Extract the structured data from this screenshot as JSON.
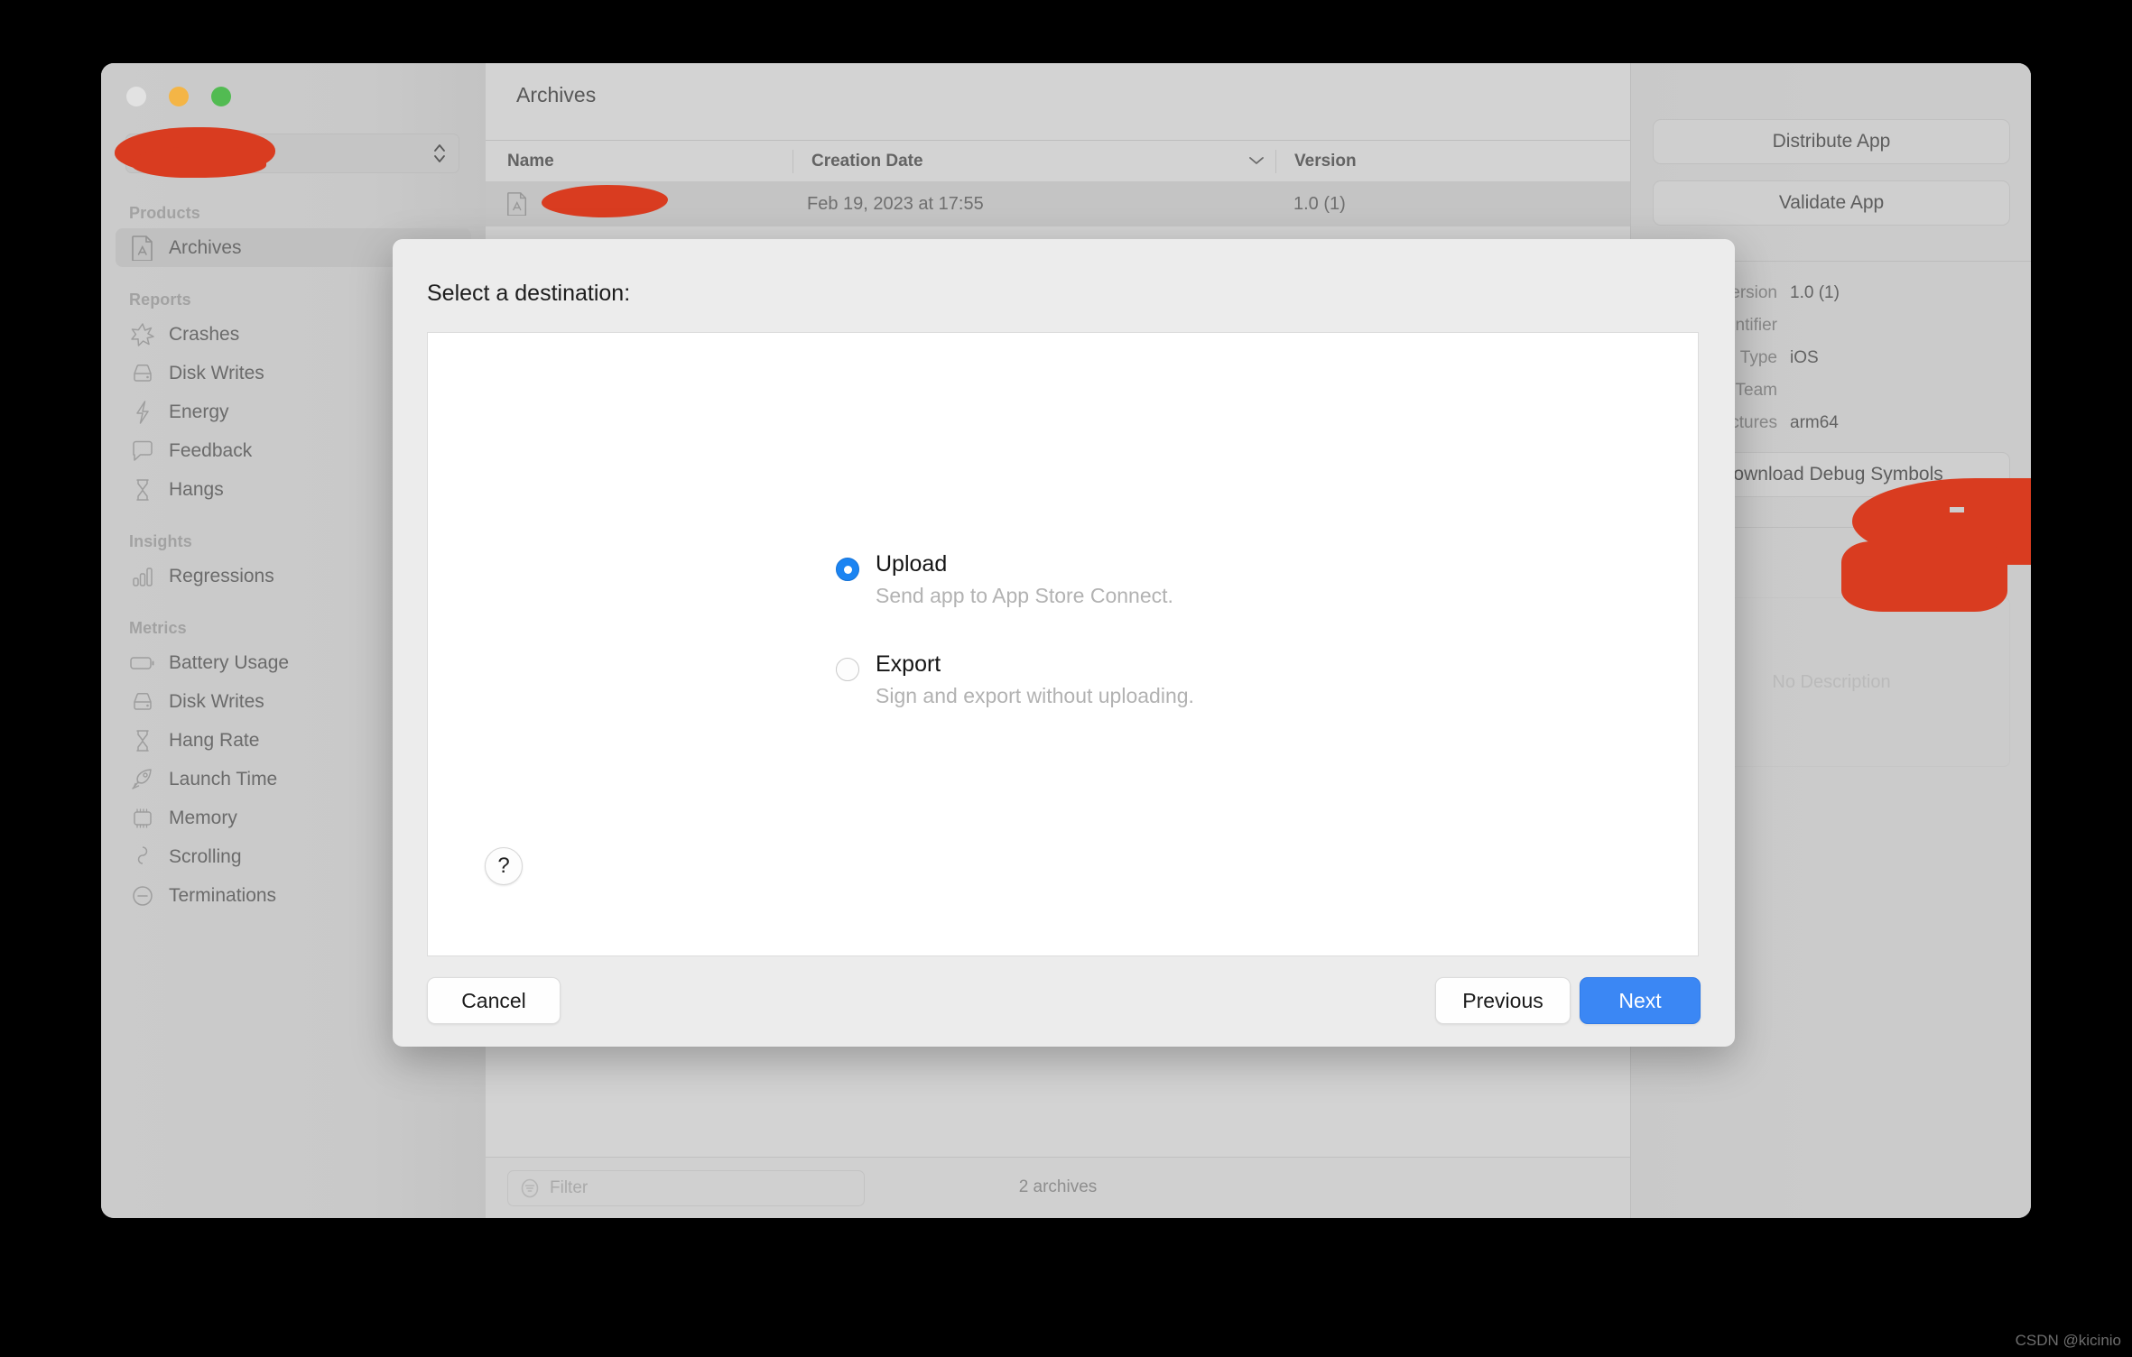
{
  "window": {
    "traffic_lights": [
      "close",
      "minimize",
      "zoom"
    ],
    "scheme_popup_value": ""
  },
  "sidebar": {
    "groups": [
      {
        "label": "Products",
        "items": [
          {
            "label": "Archives",
            "icon": "app-archive-icon",
            "selected": true
          }
        ]
      },
      {
        "label": "Reports",
        "items": [
          {
            "label": "Crashes",
            "icon": "star-burst-icon",
            "selected": false
          },
          {
            "label": "Disk Writes",
            "icon": "disk-icon",
            "selected": false
          },
          {
            "label": "Energy",
            "icon": "bolt-icon",
            "selected": false
          },
          {
            "label": "Feedback",
            "icon": "speech-bubble-icon",
            "selected": false
          },
          {
            "label": "Hangs",
            "icon": "hourglass-icon",
            "selected": false
          }
        ]
      },
      {
        "label": "Insights",
        "items": [
          {
            "label": "Regressions",
            "icon": "bar-chart-icon",
            "selected": false
          }
        ]
      },
      {
        "label": "Metrics",
        "items": [
          {
            "label": "Battery Usage",
            "icon": "battery-icon",
            "selected": false
          },
          {
            "label": "Disk Writes",
            "icon": "disk-icon",
            "selected": false
          },
          {
            "label": "Hang Rate",
            "icon": "hourglass-icon",
            "selected": false
          },
          {
            "label": "Launch Time",
            "icon": "rocket-icon",
            "selected": false
          },
          {
            "label": "Memory",
            "icon": "memory-chip-icon",
            "selected": false
          },
          {
            "label": "Scrolling",
            "icon": "scroll-icon",
            "selected": false
          },
          {
            "label": "Terminations",
            "icon": "minus-circle-icon",
            "selected": false
          }
        ]
      }
    ]
  },
  "center": {
    "title": "Archives",
    "columns": [
      "Name",
      "Creation Date",
      "Version"
    ],
    "sort_indicator": "chevron-down-icon",
    "rows": [
      {
        "name": "",
        "creation_date": "Feb 19, 2023 at 17:55",
        "version": "1.0 (1)"
      }
    ],
    "filter": {
      "placeholder": "Filter",
      "value": "",
      "icon": "filter-icon"
    },
    "status": "2 archives"
  },
  "inspector": {
    "distribute_label": "Distribute App",
    "validate_label": "Validate App",
    "download_symbols_label": "Download Debug Symbols",
    "meta": [
      {
        "key": "Version",
        "value": "1.0 (1)"
      },
      {
        "key": "Identifier",
        "value": ""
      },
      {
        "key": "Type",
        "value": "iOS"
      },
      {
        "key": "Team",
        "value": ""
      },
      {
        "key": "Architectures",
        "value": "arm64"
      }
    ],
    "description_placeholder": "No Description"
  },
  "sheet": {
    "title": "Select a destination:",
    "options": [
      {
        "label": "Upload",
        "description": "Send app to App Store Connect.",
        "selected": true
      },
      {
        "label": "Export",
        "description": "Sign and export without uploading.",
        "selected": false
      }
    ],
    "help_label": "?",
    "buttons": {
      "cancel": "Cancel",
      "previous": "Previous",
      "next": "Next"
    }
  },
  "watermark": "CSDN @kicinio",
  "colors": {
    "accent_blue": "#3b87f4",
    "radio_blue": "#1b84f2",
    "redaction_red": "#d93c20",
    "window_bg": "#cccccc"
  }
}
